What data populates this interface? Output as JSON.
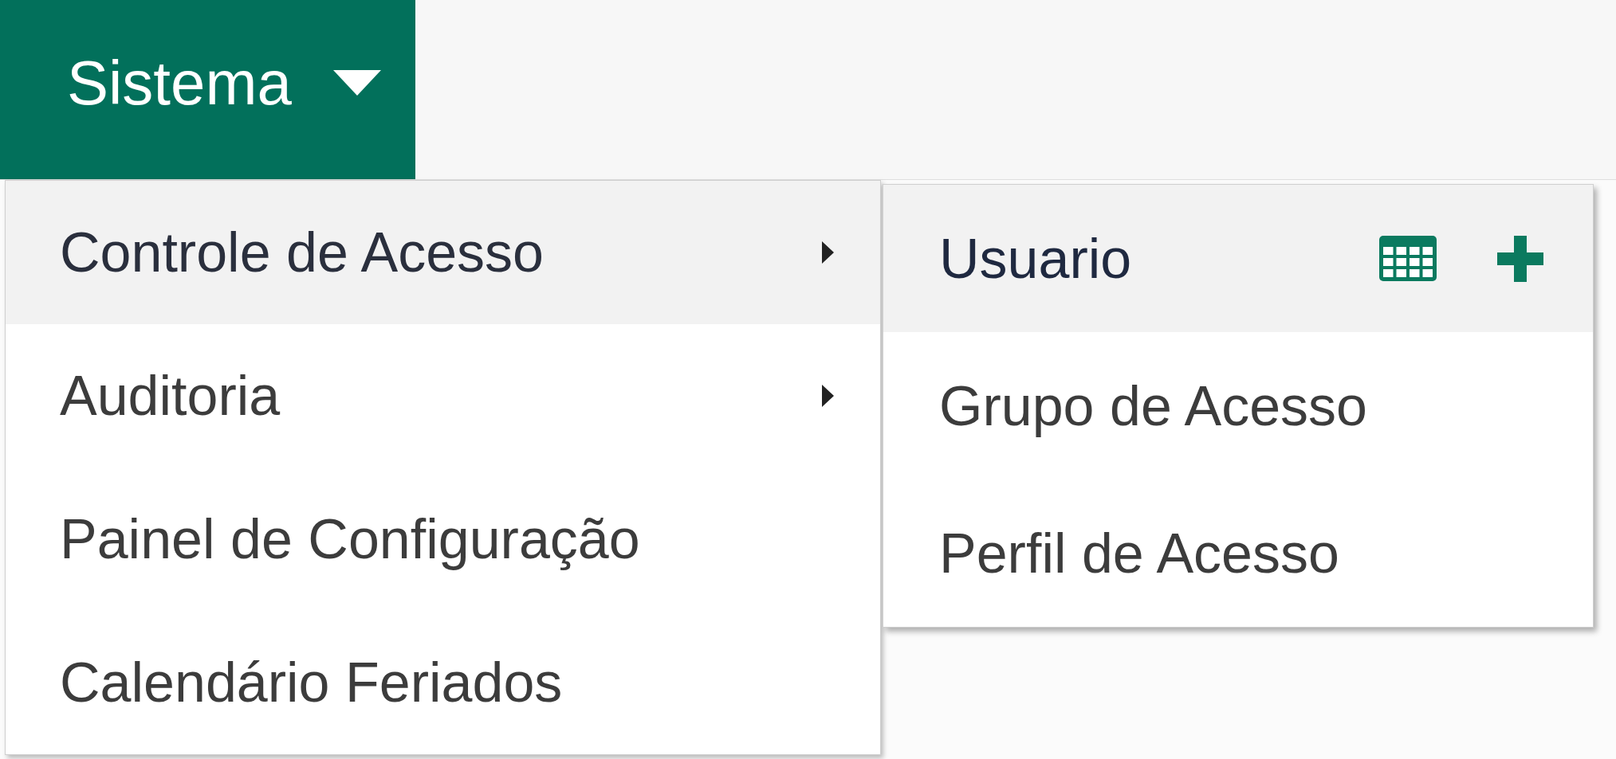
{
  "nav": {
    "label": "Sistema",
    "expanded": true
  },
  "menu": {
    "items": [
      {
        "label": "Controle de Acesso",
        "has_submenu": true,
        "selected": true,
        "children": [
          {
            "label": "Usuario",
            "selected": true
          },
          {
            "label": "Grupo de Acesso",
            "selected": false
          },
          {
            "label": "Perfil de Acesso",
            "selected": false
          }
        ]
      },
      {
        "label": "Auditoria",
        "has_submenu": true,
        "selected": false
      },
      {
        "label": "Painel de Configuração",
        "has_submenu": false,
        "selected": false
      },
      {
        "label": "Calendário Feriados",
        "has_submenu": false,
        "selected": false
      }
    ]
  }
}
